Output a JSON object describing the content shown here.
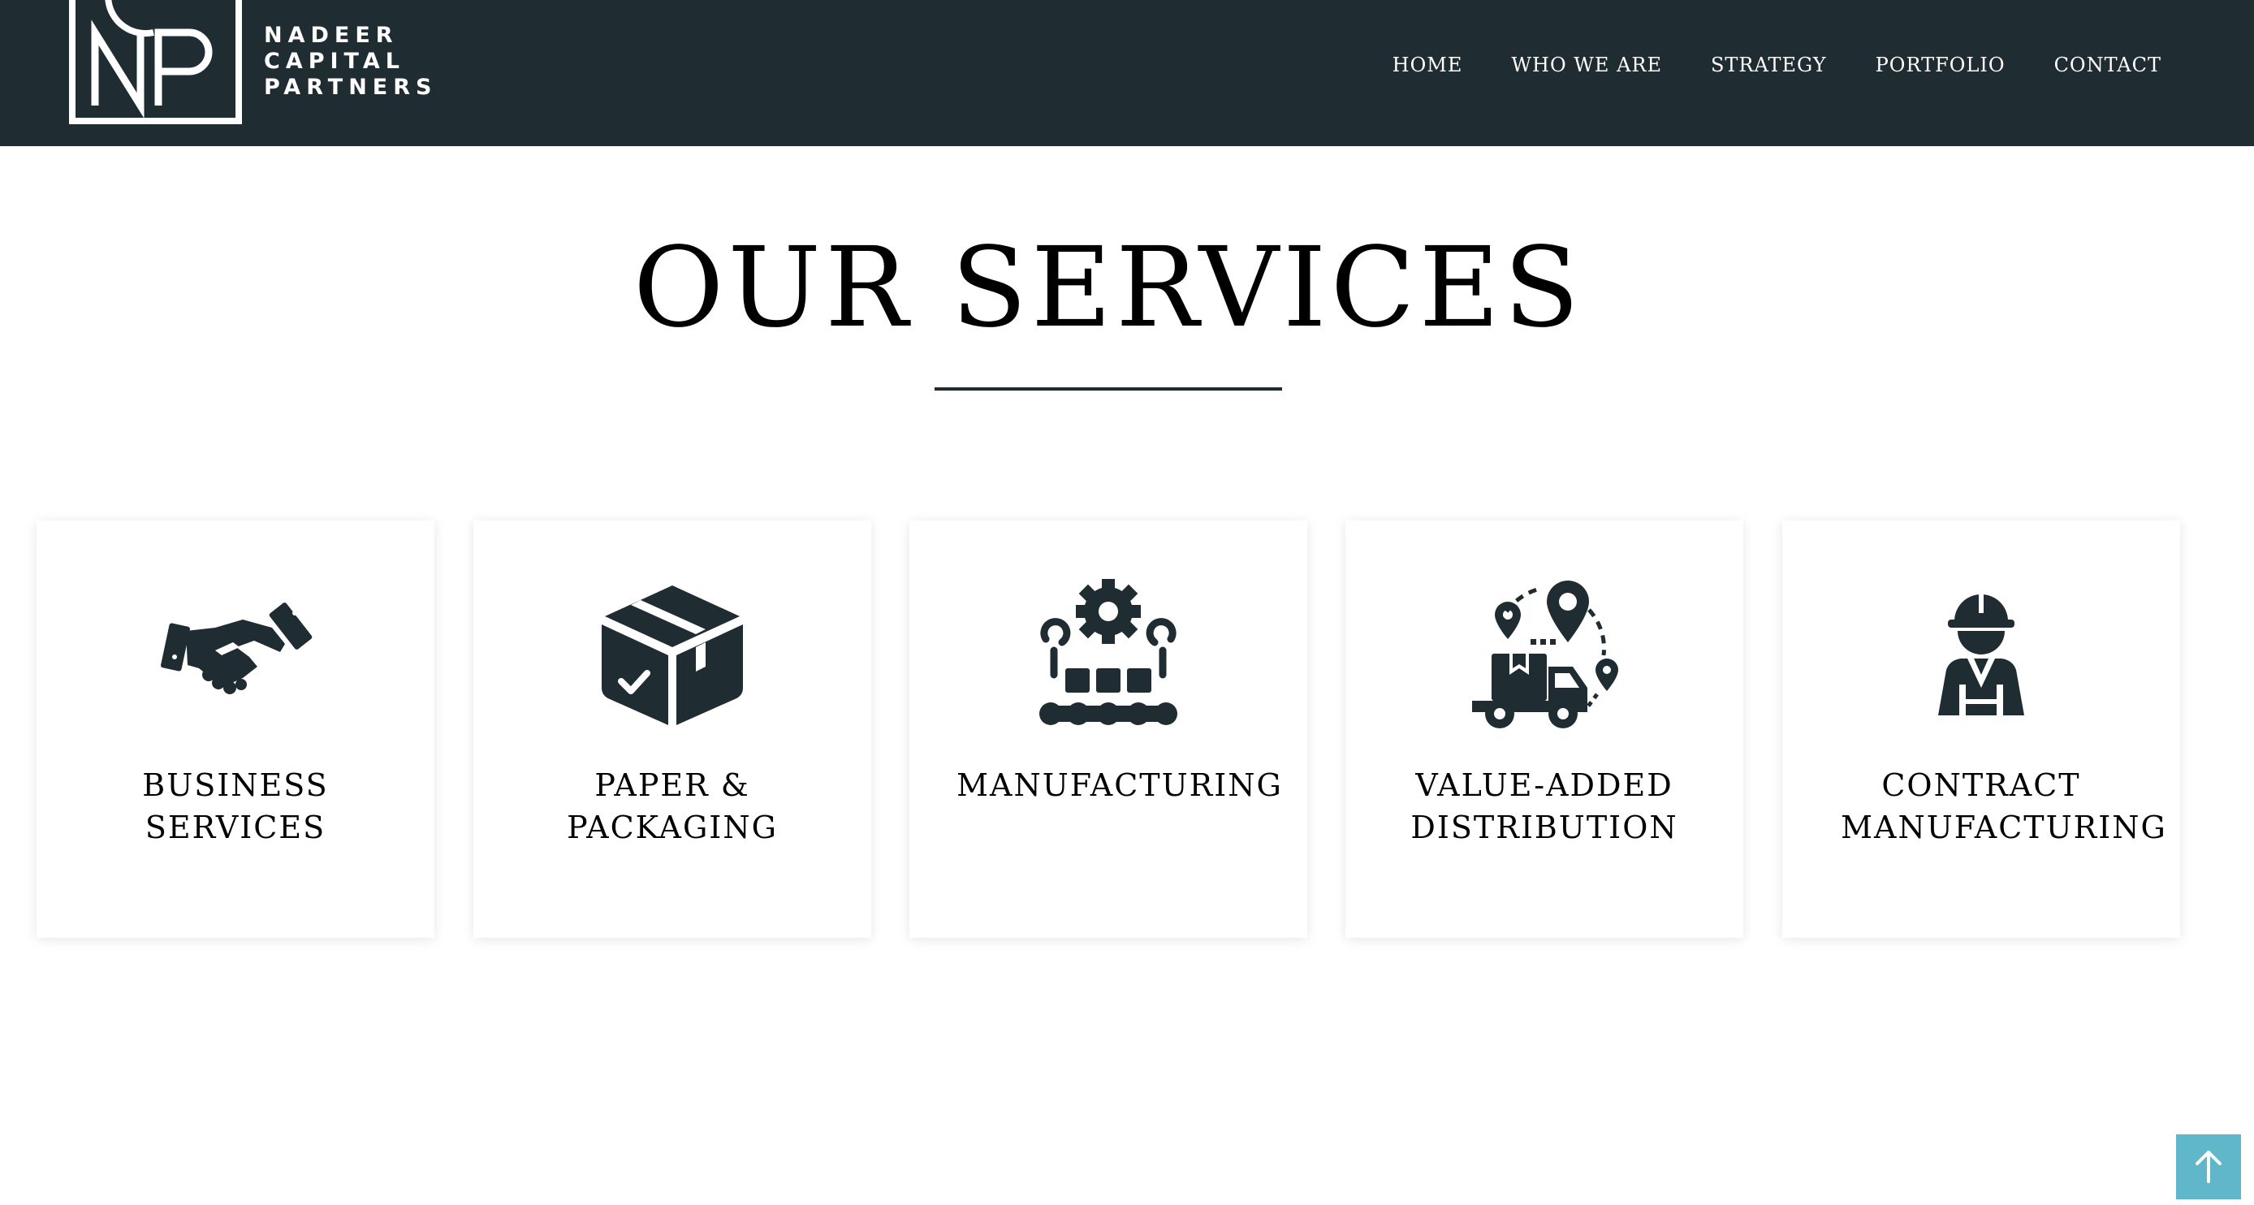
{
  "brand": {
    "logo_text": [
      "NADEER",
      "CAPITAL",
      "PARTNERS"
    ],
    "monogram": "NCP"
  },
  "nav": [
    {
      "label": "HOME"
    },
    {
      "label": "WHO WE ARE"
    },
    {
      "label": "STRATEGY"
    },
    {
      "label": "PORTFOLIO"
    },
    {
      "label": "CONTACT"
    }
  ],
  "services": {
    "title": "OUR SERVICES",
    "cards": [
      {
        "icon": "handshake-icon",
        "label": [
          "BUSINESS",
          "SERVICES"
        ]
      },
      {
        "icon": "box-icon",
        "label": [
          "PAPER &",
          "PACKAGING"
        ]
      },
      {
        "icon": "factory-conveyor-icon",
        "label": [
          "MANUFACTURING"
        ]
      },
      {
        "icon": "delivery-truck-icon",
        "label": [
          "VALUE-ADDED",
          "DISTRIBUTION"
        ]
      },
      {
        "icon": "worker-icon",
        "label": [
          "CONTRACT",
          "MANUFACTURING"
        ]
      }
    ]
  },
  "back_to_top": {
    "icon": "arrow-up-icon"
  },
  "colors": {
    "header_bg": "#1f2d33",
    "icon": "#1f2d33",
    "accent": "#5fb7c9",
    "text": "#000000"
  }
}
